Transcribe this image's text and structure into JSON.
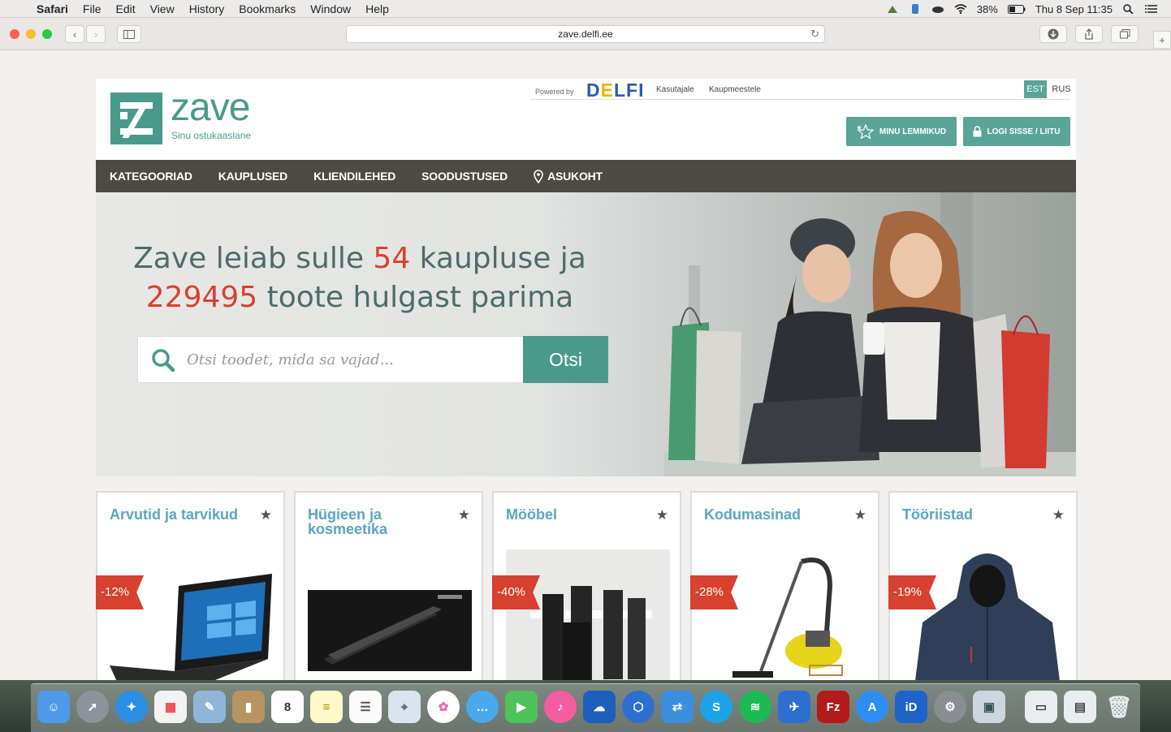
{
  "menubar": {
    "app": "Safari",
    "items": [
      "File",
      "Edit",
      "View",
      "History",
      "Bookmarks",
      "Window",
      "Help"
    ],
    "battery": "38%",
    "clock": "Thu 8 Sep  11:35"
  },
  "browser": {
    "url": "zave.delfi.ee"
  },
  "header": {
    "logo_word": "zave",
    "logo_tagline": "Sinu ostukaaslane",
    "powered_by": "Powered by",
    "delfi_d": "D",
    "delfi_e": "E",
    "delfi_rest": "LFI",
    "links": [
      "Kasutajale",
      "Kaupmeestele"
    ],
    "languages": [
      "EST",
      "RUS"
    ],
    "favorites_button": "MINU LEMMIKUD",
    "login_button": "LOGI SISSE / LIITU"
  },
  "nav": {
    "items": [
      "KATEGOORIAD",
      "KAUPLUSED",
      "KLIENDILEHED",
      "SOODUSTUSED",
      "ASUKOHT"
    ]
  },
  "hero": {
    "line1_a": "Zave leiab sulle ",
    "stores_count": "54",
    "line1_b": " kaupluse ja",
    "products_count": "229495",
    "line2_b": " toote hulgast parima",
    "search_placeholder": "Otsi toodet, mida sa vajad...",
    "search_button": "Otsi"
  },
  "categories": [
    {
      "title": "Arvutid ja tarvikud",
      "discount": "-12%"
    },
    {
      "title": "Hügieen ja kosmeetika",
      "discount": ""
    },
    {
      "title": "Mööbel",
      "discount": "-40%"
    },
    {
      "title": "Kodumasinad",
      "discount": "-28%"
    },
    {
      "title": "Tööriistad",
      "discount": "-19%"
    }
  ],
  "colors": {
    "brand_teal": "#4a9a8c",
    "accent_red": "#d8402f",
    "nav_dark": "#4b4a45",
    "category_blue": "#5ba5c4"
  }
}
